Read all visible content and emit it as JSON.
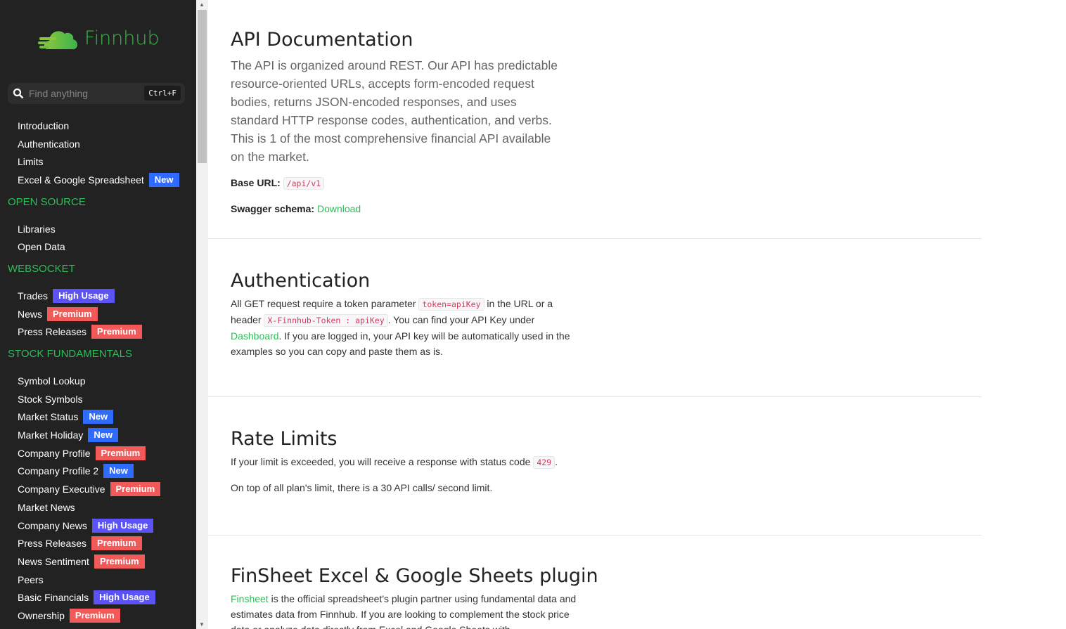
{
  "sidebar": {
    "logo_text": "Finnhub",
    "search": {
      "placeholder": "Find anything",
      "shortcut": "Ctrl+F"
    },
    "groups": [
      {
        "title": null,
        "items": [
          {
            "label": "Introduction"
          },
          {
            "label": "Authentication"
          },
          {
            "label": "Limits"
          },
          {
            "label": "Excel & Google Spreadsheet",
            "badge": "New"
          }
        ]
      },
      {
        "title": "OPEN SOURCE",
        "items": [
          {
            "label": "Libraries"
          },
          {
            "label": "Open Data"
          }
        ]
      },
      {
        "title": "WEBSOCKET",
        "items": [
          {
            "label": "Trades",
            "badge": "High Usage"
          },
          {
            "label": "News",
            "badge": "Premium"
          },
          {
            "label": "Press Releases",
            "badge": "Premium"
          }
        ]
      },
      {
        "title": "STOCK FUNDAMENTALS",
        "items": [
          {
            "label": "Symbol Lookup"
          },
          {
            "label": "Stock Symbols"
          },
          {
            "label": "Market Status",
            "badge": "New"
          },
          {
            "label": "Market Holiday",
            "badge": "New"
          },
          {
            "label": "Company Profile",
            "badge": "Premium"
          },
          {
            "label": "Company Profile 2",
            "badge": "New"
          },
          {
            "label": "Company Executive",
            "badge": "Premium"
          },
          {
            "label": "Market News"
          },
          {
            "label": "Company News",
            "badge": "High Usage"
          },
          {
            "label": "Press Releases",
            "badge": "Premium"
          },
          {
            "label": "News Sentiment",
            "badge": "Premium"
          },
          {
            "label": "Peers"
          },
          {
            "label": "Basic Financials",
            "badge": "High Usage"
          },
          {
            "label": "Ownership",
            "badge": "Premium"
          }
        ]
      }
    ]
  },
  "colors": {
    "green": "#2ebd59",
    "new": "#2f6bff",
    "premium": "#f25a5a",
    "high_usage": "#5b53f5"
  },
  "intro": {
    "title": "API Documentation",
    "lead": "The API is organized around REST. Our API has predictable resource-oriented URLs, accepts form-encoded request bodies, returns JSON-encoded responses, and uses standard HTTP response codes, authentication, and verbs. This is 1 of the most comprehensive financial API available on the market.",
    "base_url_label": "Base URL",
    "base_url": "/api/v1",
    "swagger_label": "Swagger schema",
    "swagger_link": "Download"
  },
  "auth": {
    "title": "Authentication",
    "t1": "All GET request require a token parameter ",
    "code1": "token=apiKey",
    "t2": " in the URL or a header ",
    "code2": "X-Finnhub-Token : apiKey",
    "t3": ". You can find your API Key under ",
    "link": "Dashboard",
    "t4": ". If you are logged in, your API key will be automatically used in the examples so you can copy and paste them as is."
  },
  "limits": {
    "title": "Rate Limits",
    "t1": "If your limit is exceeded, you will receive a response with status code ",
    "code": "429",
    "t2": ".",
    "p2": "On top of all plan's limit, there is a 30 API calls/ second limit."
  },
  "finsheet": {
    "title": "FinSheet Excel & Google Sheets plugin",
    "link": "Finsheet",
    "t1": " is the official spreadsheet's plugin partner using fundamental data and estimates data from Finnhub. If you are looking to complement the stock price data or analyze data directly from Excel and Google Sheets with"
  }
}
